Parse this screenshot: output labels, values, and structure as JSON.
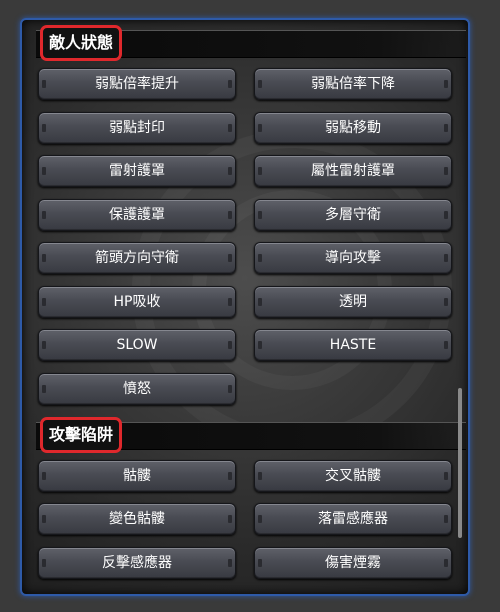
{
  "sections": [
    {
      "title": "敵人狀態",
      "buttons": [
        "弱點倍率提升",
        "弱點倍率下降",
        "弱點封印",
        "弱點移動",
        "雷射護罩",
        "屬性雷射護罩",
        "保護護罩",
        "多層守衛",
        "箭頭方向守衛",
        "導向攻擊",
        "HP吸收",
        "透明",
        "SLOW",
        "HASTE",
        "憤怒"
      ]
    },
    {
      "title": "攻擊陷阱",
      "buttons": [
        "骷髏",
        "交叉骷髏",
        "變色骷髏",
        "落雷感應器",
        "反擊感應器",
        "傷害煙霧"
      ]
    }
  ]
}
